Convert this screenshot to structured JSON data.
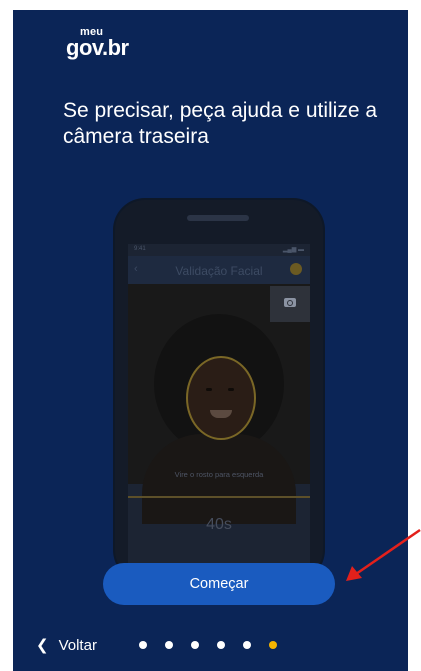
{
  "logo": {
    "top": "meu",
    "main": "gov.br"
  },
  "heading": "Se precisar, peça ajuda e utilize a câmera traseira",
  "illustration": {
    "status_time": "9:41",
    "screen_title": "Validação Facial",
    "instruction": "Vire o rosto para esquerda",
    "timer": "40s"
  },
  "primary_button": "Começar",
  "footer": {
    "back_label": "Voltar",
    "pager": {
      "count": 6,
      "active": 6
    }
  },
  "colors": {
    "background": "#0b2557",
    "button": "#1a5bbf",
    "active_dot": "#f5b400",
    "annotation_arrow": "#e3201b"
  }
}
